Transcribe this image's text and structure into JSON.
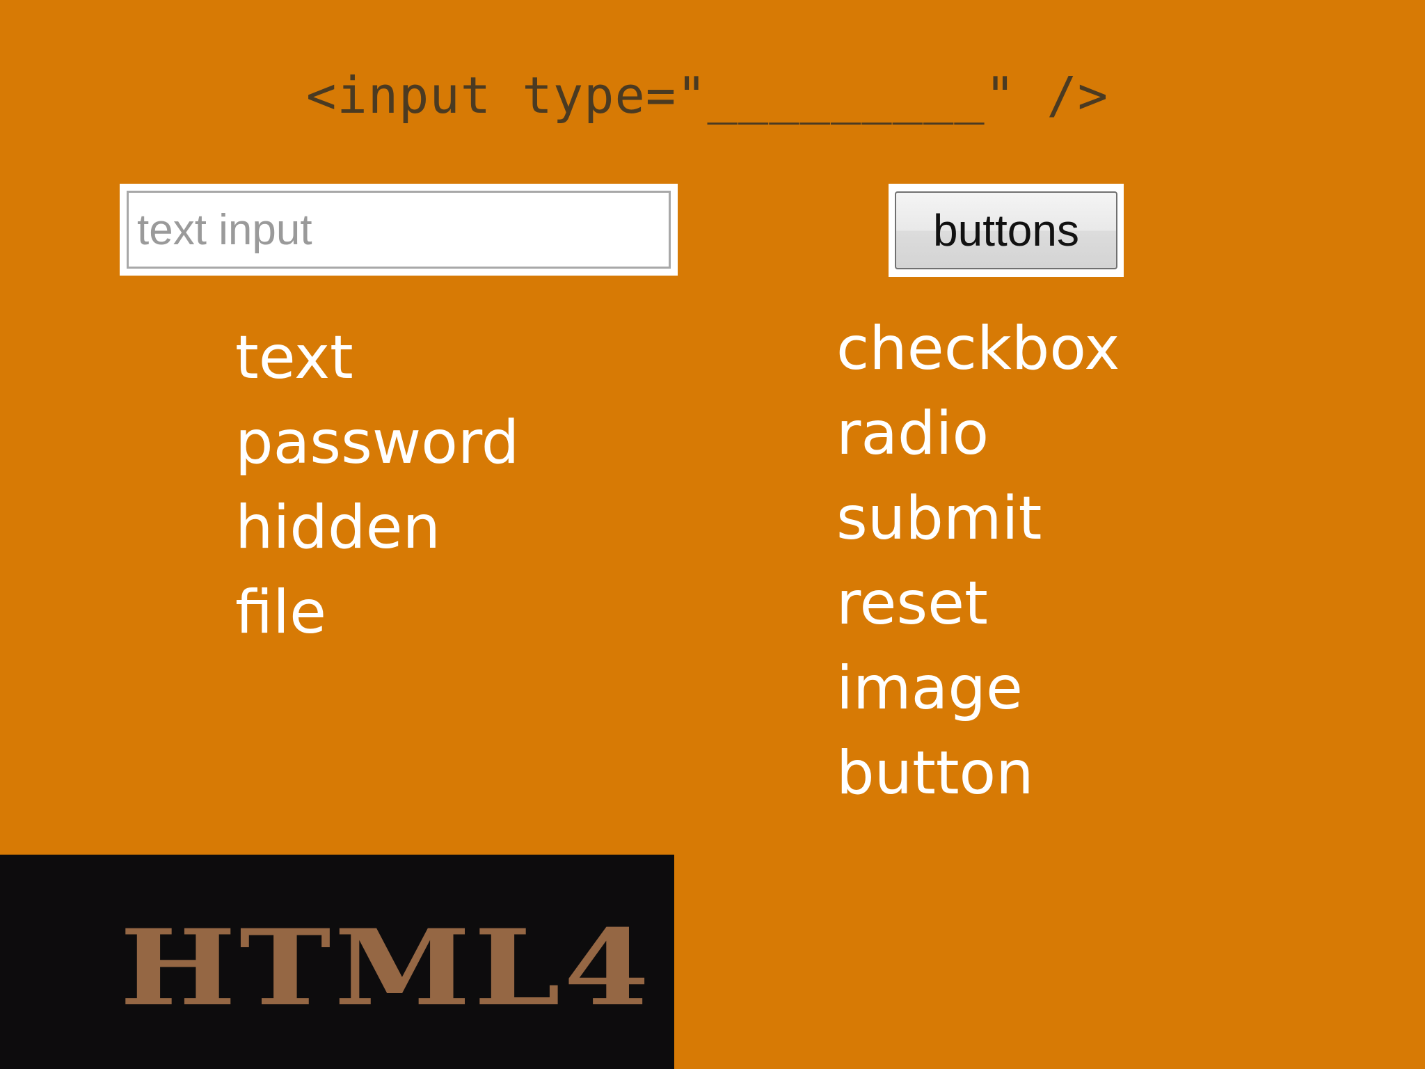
{
  "heading": {
    "code": "<input type=\"_________\" />"
  },
  "demo_controls": {
    "text_input_placeholder": "text input",
    "button_label": "buttons"
  },
  "input_types": {
    "text_inputs": [
      "text",
      "password",
      "hidden",
      "file"
    ],
    "buttons": [
      "checkbox",
      "radio",
      "submit",
      "reset",
      "image",
      "button"
    ]
  },
  "footer": {
    "logo_text": "HTML4"
  },
  "colors": {
    "background": "#d77a05",
    "footer_background": "#0d0c0d",
    "logo": "#956744",
    "heading_text": "#4a3a22",
    "list_text": "#ffffff"
  }
}
